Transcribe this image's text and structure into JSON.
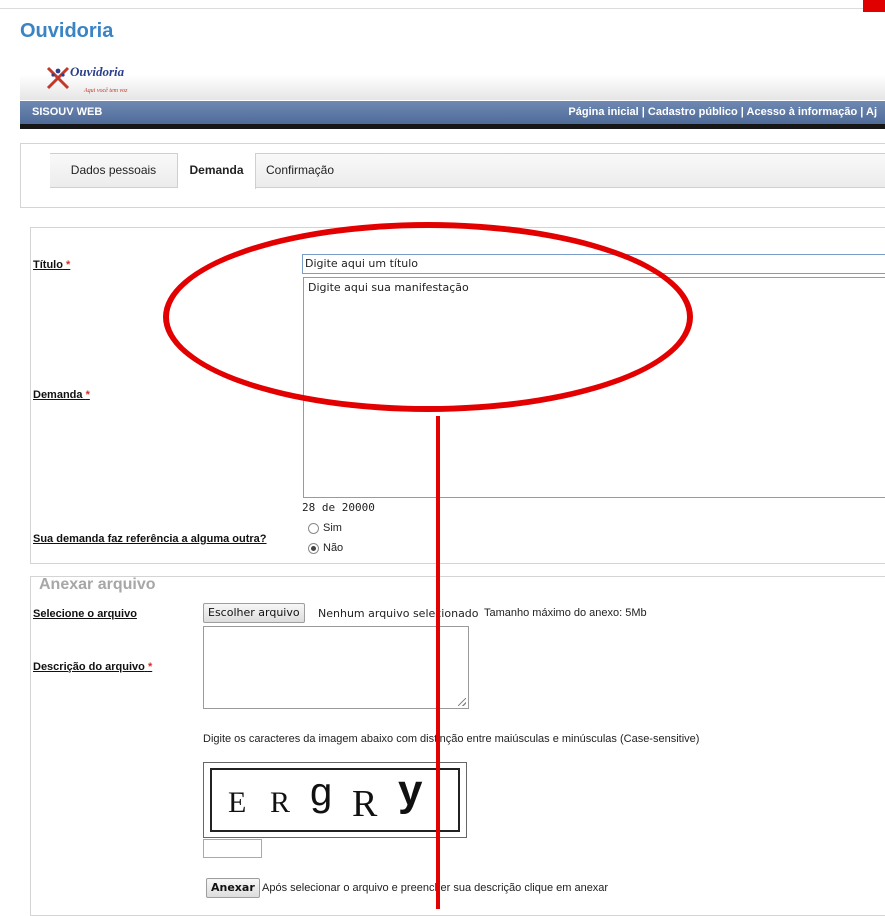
{
  "page": {
    "title": "Ouvidoria"
  },
  "logo": {
    "brand": "Ouvidoria",
    "tagline": "Aqui você tem voz"
  },
  "navbar": {
    "system_name": "SISOUV WEB",
    "links": [
      "Página inicial",
      "Cadastro público",
      "Acesso à informação",
      "Aj"
    ],
    "separator": " | "
  },
  "tabs": [
    {
      "label": "Dados pessoais",
      "active": false
    },
    {
      "label": "Demanda",
      "active": true
    },
    {
      "label": "Confirmação",
      "active": false
    }
  ],
  "form": {
    "title_label": "Título",
    "title_placeholder": "Digite aqui um título",
    "demand_label": "Demanda",
    "demand_placeholder": "Digite aqui sua manifestação",
    "required_mark": "*",
    "counter_current": "28",
    "counter_sep": "de",
    "counter_max": "20000",
    "reference_question": "Sua demanda faz referência a alguma outra?",
    "reference_options": [
      {
        "label": "Sim",
        "checked": false
      },
      {
        "label": "Não",
        "checked": true
      }
    ]
  },
  "attach": {
    "legend": "Anexar arquivo",
    "file_label": "Selecione o arquivo",
    "choose_button": "Escolher arquivo",
    "no_file_text": "Nenhum arquivo selecionado",
    "max_size_text": "Tamanho máximo do anexo: 5Mb",
    "description_label": "Descrição do arquivo",
    "captcha_instructions": "Digite os caracteres da imagem abaixo com distinção entre maiúsculas e minúsculas (Case-sensitive)",
    "captcha_chars": [
      "E",
      "R",
      "g",
      "R",
      "y"
    ],
    "attach_button": "Anexar",
    "attach_hint": "Após selecionar o arquivo e preencher sua descrição clique em anexar"
  },
  "colors": {
    "title_blue": "#3a84c4",
    "navbar": "#5b76a3",
    "annotation_red": "#e30000",
    "required_red": "#d62b2b"
  }
}
